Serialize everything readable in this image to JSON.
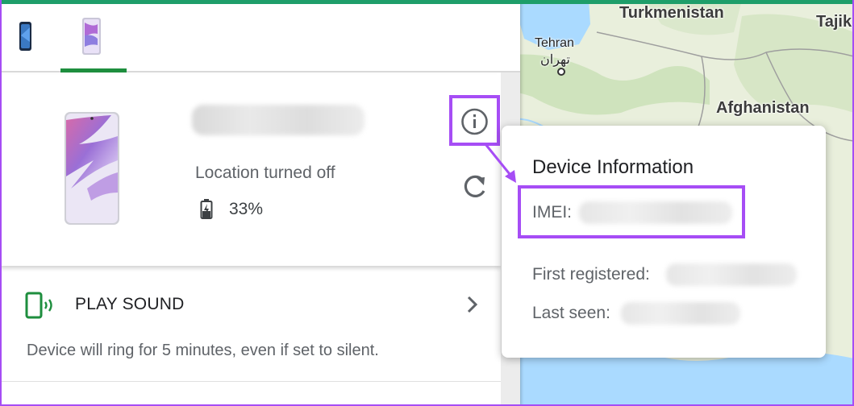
{
  "tabs": [
    {
      "name": "phone-1",
      "active": false
    },
    {
      "name": "phone-2",
      "active": true
    }
  ],
  "device": {
    "location_status": "Location turned off",
    "battery_level": "33%"
  },
  "actions": {
    "play_sound_label": "PLAY SOUND",
    "play_sound_description": "Device will ring for 5 minutes, even if set to silent."
  },
  "popup": {
    "title": "Device Information",
    "imei_label": "IMEI:",
    "first_registered_label": "First registered:",
    "last_seen_label": "Last seen:"
  },
  "map": {
    "labels": [
      "Turkmenistan",
      "Tajik",
      "Tehran",
      "تهران",
      "Afghanistan"
    ]
  },
  "colors": {
    "accent_green": "#1e8e3e",
    "highlight_purple": "#a64df5",
    "map_land": "#e9efdc",
    "map_water": "#aadaff"
  },
  "icons": {
    "info": "info-circle-icon",
    "refresh": "refresh-icon",
    "play_sound": "phone-ring-icon",
    "chevron": "chevron-right-icon",
    "battery": "battery-icon"
  }
}
